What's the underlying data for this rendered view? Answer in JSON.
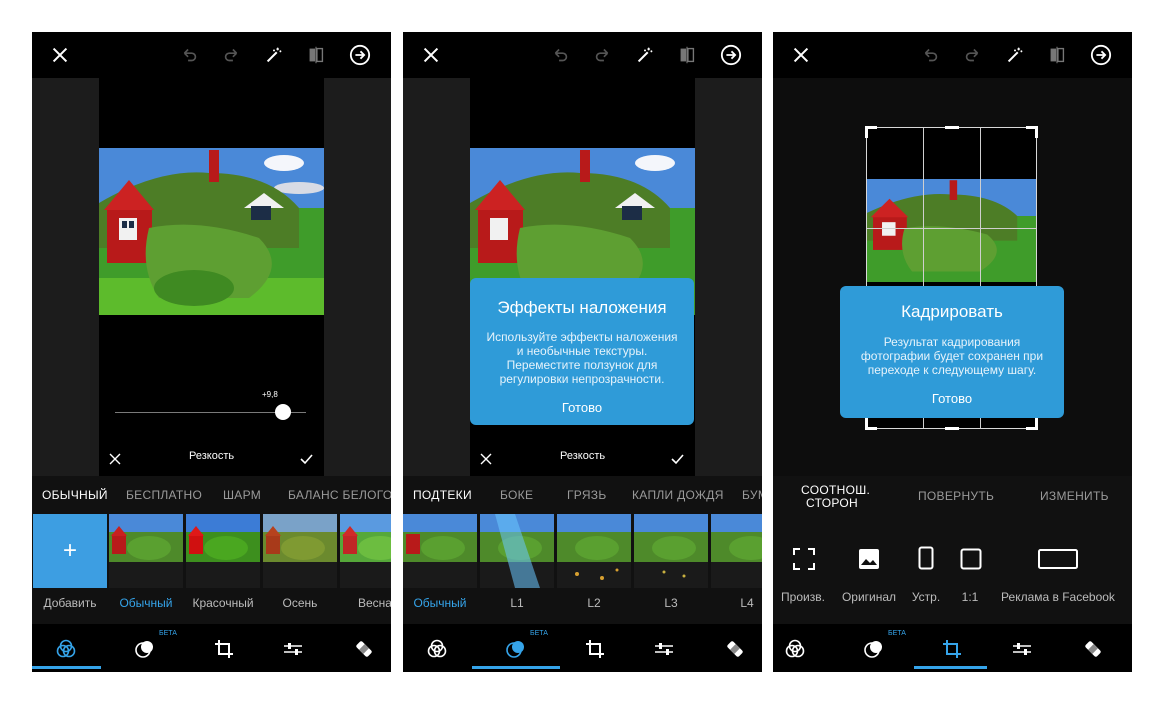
{
  "screens": [
    {
      "tabs": [
        "ОБЫЧНЫЙ",
        "БЕСПЛАТНО",
        "ШАРМ",
        "БАЛАНС БЕЛОГО"
      ],
      "thumb_labels": [
        "Добавить",
        "Обычный",
        "Красочный",
        "Осень",
        "Весна"
      ],
      "slider_value": "+9,8",
      "slider_level": 0.88,
      "tool_name": "Резкость",
      "add_symbol": "+"
    },
    {
      "tabs": [
        "ПОДТЕКИ",
        "БОКЕ",
        "ГРЯЗЬ",
        "КАПЛИ ДОЖДЯ",
        "БУМ"
      ],
      "thumb_labels": [
        "Обычный",
        "L1",
        "L2",
        "L3",
        "L4"
      ],
      "tool_name": "Резкость",
      "popup": {
        "title": "Эффекты наложения",
        "body_lines": [
          "Используйте эффекты наложения",
          "и необычные текстуры.",
          "Переместите ползунок для",
          "регулировки непрозрачности."
        ],
        "button": "Готово"
      }
    },
    {
      "tabs": [
        "СООТНОШ.",
        "СТОРОН",
        "ПОВЕРНУТЬ",
        "ИЗМЕНИТЬ"
      ],
      "crop_options": [
        "Произв.",
        "Оригинал",
        "Устр.",
        "1:1",
        "Реклама в Facebook"
      ],
      "popup": {
        "title": "Кадрировать",
        "body_lines": [
          "Результат кадрирования",
          "фотографии будет сохранен при",
          "переходе к следующему шагу."
        ],
        "button": "Готово"
      }
    }
  ],
  "beta_label": "БЕТА",
  "icons": {
    "top": [
      "close-icon",
      "undo-icon",
      "redo-icon",
      "magic-wand-icon",
      "compare-icon",
      "next-arrow-icon"
    ],
    "bottom": [
      "filters-icon",
      "overlay-icon",
      "crop-icon",
      "adjust-icon",
      "healing-icon"
    ]
  },
  "colors": {
    "accent": "#35a4ea",
    "popup": "#2f9bd8",
    "background": "#0d0d0d"
  }
}
